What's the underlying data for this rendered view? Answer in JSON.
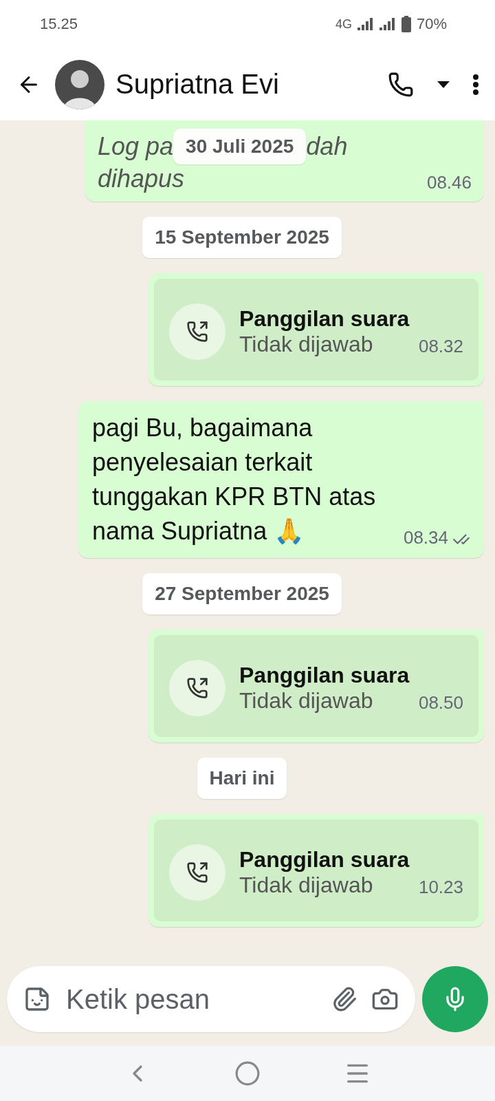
{
  "status_bar": {
    "time": "15.25",
    "network": "4G",
    "battery": "70%"
  },
  "header": {
    "contact_name": "Supriatna Evi"
  },
  "messages": [
    {
      "kind": "deleted",
      "text_start": "Log pa",
      "overlay_date": "30 Juli 2025",
      "text_end": "dah",
      "text_line2": "dihapus",
      "time": "08.46"
    },
    {
      "kind": "date",
      "label": "15 September 2025"
    },
    {
      "kind": "call",
      "title": "Panggilan suara",
      "subtitle": "Tidak dijawab",
      "time": "08.32"
    },
    {
      "kind": "text",
      "text": "pagi Bu, bagaimana penyelesaian terkait tunggakan KPR BTN atas nama Supriatna 🙏",
      "time": "08.34",
      "read": false
    },
    {
      "kind": "date",
      "label": "27 September 2025"
    },
    {
      "kind": "call",
      "title": "Panggilan suara",
      "subtitle": "Tidak dijawab",
      "time": "08.50"
    },
    {
      "kind": "date",
      "label": "Hari ini"
    },
    {
      "kind": "call",
      "title": "Panggilan suara",
      "subtitle": "Tidak dijawab",
      "time": "10.23"
    }
  ],
  "composer": {
    "placeholder": "Ketik pesan"
  }
}
